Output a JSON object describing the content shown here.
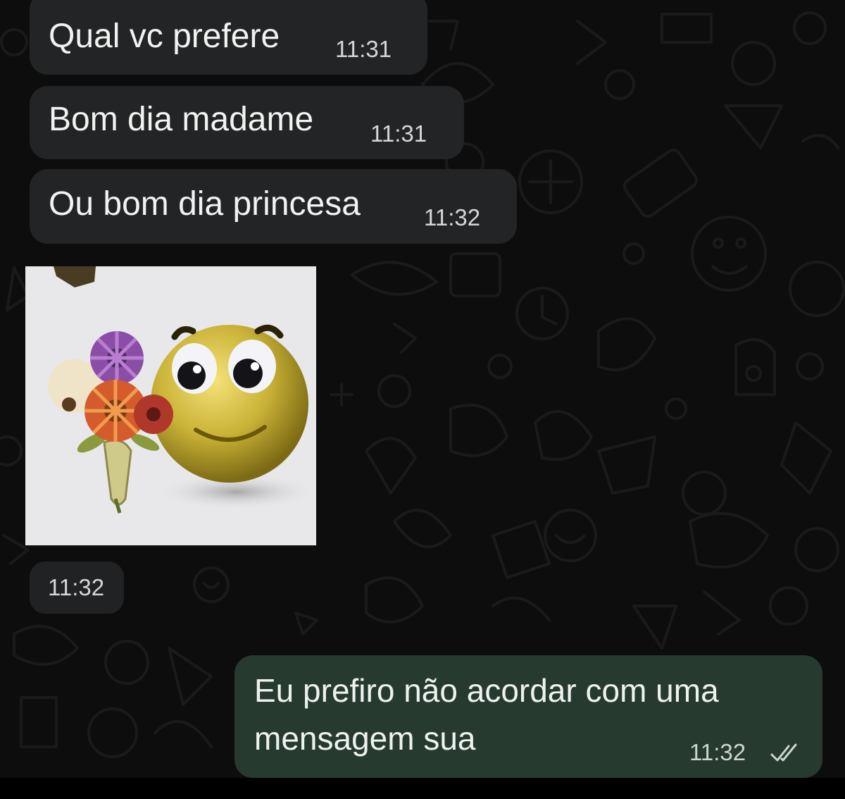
{
  "messages": {
    "incoming": [
      {
        "text": "Qual vc prefere",
        "time": "11:31"
      },
      {
        "text": "Bom dia madame",
        "time": "11:31"
      },
      {
        "text": "Ou bom dia princesa",
        "time": "11:32"
      }
    ],
    "image_message": {
      "sticker_icon": "emoji-with-flowers-icon",
      "time": "11:32"
    },
    "outgoing": {
      "line1": "Eu prefiro não acordar com uma",
      "line2": "mensagem sua",
      "time": "11:32",
      "status_icon": "double-check-icon"
    }
  },
  "colors": {
    "background": "#0d0d0d",
    "incoming_bubble": "#232425",
    "outgoing_bubble": "#263a30",
    "text": "#f2f2f2"
  }
}
